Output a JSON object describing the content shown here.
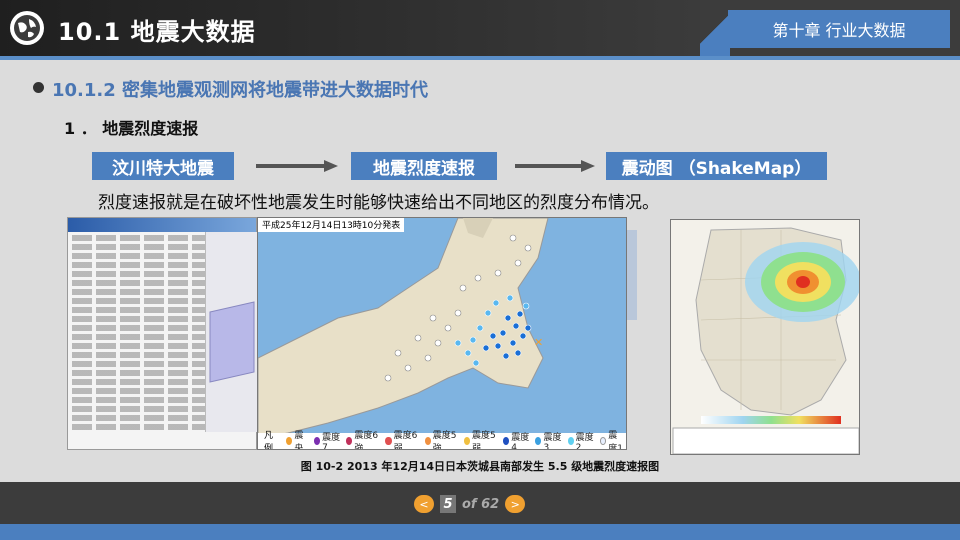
{
  "header": {
    "title": "10.1 地震大数据",
    "chapter": "第十章 行业大数据"
  },
  "section": {
    "title": "10.1.2  密集地震观测网将地震带进大数据时代",
    "subtitle": "1 ． 地震烈度速报"
  },
  "flow": {
    "step1": "汶川特大地震",
    "step2": "地震烈度速报",
    "step3": "震动图 （ShakeMap）"
  },
  "description": "烈度速报就是在破坏性地震发生时能够快速给出不同地区的烈度分布情况。",
  "figure": {
    "map_title": "平成25年12月14日13時10分発表",
    "legend_label": "凡 例",
    "legend_items": [
      {
        "label": "震央",
        "color": "#f0a030"
      },
      {
        "label": "震度7",
        "color": "#7b2fb0"
      },
      {
        "label": "震度6強",
        "color": "#c0305a"
      },
      {
        "label": "震度6弱",
        "color": "#e05050"
      },
      {
        "label": "震度5強",
        "color": "#f09040"
      },
      {
        "label": "震度5弱",
        "color": "#f0c040"
      },
      {
        "label": "震度4",
        "color": "#2050c0"
      },
      {
        "label": "震度3",
        "color": "#3aa0e0"
      },
      {
        "label": "震度2",
        "color": "#60d0f0"
      },
      {
        "label": "震度1",
        "color": "#e8f0ff"
      }
    ],
    "caption": "图 10-2  2013 年12月14日日本茨城县南部发生 5.5 级地震烈度速报图"
  },
  "pager": {
    "current": "5",
    "label": "of  62"
  },
  "colors": {
    "accent": "#4b7fbf",
    "dark": "#3c3c3c"
  }
}
